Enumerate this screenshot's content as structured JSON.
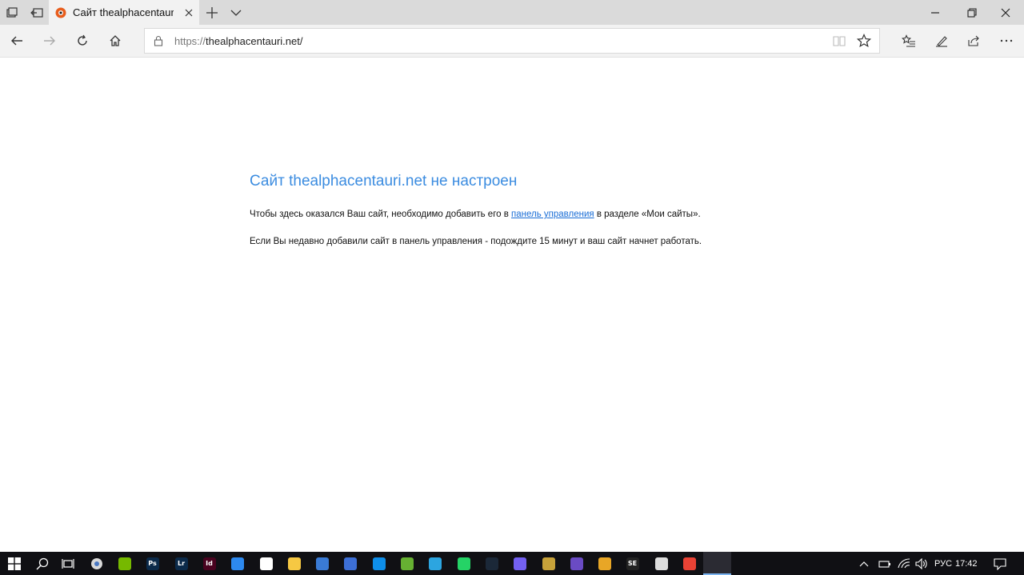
{
  "browser": {
    "tab": {
      "title": "Сайт thealphacentauri.r"
    },
    "address": {
      "protocol": "https://",
      "host": "thealphacentauri.net/"
    }
  },
  "page": {
    "heading": "Сайт thealphacentauri.net не настроен",
    "para1_before": "Чтобы здесь оказался Ваш сайт, необходимо добавить его в ",
    "para1_link": "панель управления",
    "para1_after": " в разделе «Мои сайты».",
    "para2": "Если Вы недавно добавили сайт в панель управления - подождите 15 минут и ваш сайт начнет работать."
  },
  "taskbar": {
    "language": "РУС",
    "time": "17:42",
    "apps": [
      {
        "name": "nvidia-icon",
        "label": "",
        "color": "#76b900"
      },
      {
        "name": "photoshop-icon",
        "label": "Ps",
        "color": "#0b2a4a"
      },
      {
        "name": "lightroom-icon",
        "label": "Lr",
        "color": "#0b2a4a"
      },
      {
        "name": "indesign-icon",
        "label": "Id",
        "color": "#49021f"
      },
      {
        "name": "image-viewer-icon",
        "label": "",
        "color": "#2d89ef"
      },
      {
        "name": "mail-icon",
        "label": "",
        "color": "#ffffff"
      },
      {
        "name": "file-explorer-icon",
        "label": "",
        "color": "#f6c843"
      },
      {
        "name": "network-app-icon",
        "label": "",
        "color": "#3a7bd5"
      },
      {
        "name": "save-app-icon",
        "label": "",
        "color": "#3d6fd6"
      },
      {
        "name": "teamviewer-icon",
        "label": "",
        "color": "#0e8ee9"
      },
      {
        "name": "utorrent-icon",
        "label": "",
        "color": "#66b032"
      },
      {
        "name": "telegram-icon",
        "label": "",
        "color": "#2ca5e0"
      },
      {
        "name": "whatsapp-icon",
        "label": "",
        "color": "#25d366"
      },
      {
        "name": "steam-icon",
        "label": "",
        "color": "#1b2838"
      },
      {
        "name": "viber-icon",
        "label": "",
        "color": "#7360f2"
      },
      {
        "name": "game-icon",
        "label": "",
        "color": "#c7a23a"
      },
      {
        "name": "moon-app-icon",
        "label": "",
        "color": "#6a4bc4"
      },
      {
        "name": "lightning-app-icon",
        "label": "",
        "color": "#e8a626"
      },
      {
        "name": "se-app-icon",
        "label": "SE",
        "color": "#222222"
      },
      {
        "name": "airplane-app-icon",
        "label": "",
        "color": "#dddddd"
      },
      {
        "name": "chrome-icon",
        "label": "",
        "color": "#e94235"
      },
      {
        "name": "edge-icon",
        "label": "",
        "color": "#1e8ee8"
      }
    ]
  },
  "colors": {
    "heading": "#3b8ce0",
    "link": "#1a6ed6",
    "taskbar": "#101014"
  }
}
